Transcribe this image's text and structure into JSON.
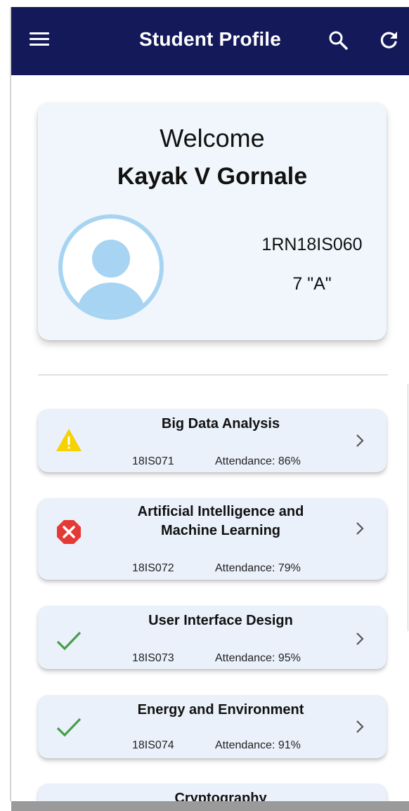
{
  "appbar": {
    "title": "Student Profile",
    "background": "#14195a"
  },
  "profile": {
    "welcome": "Welcome",
    "name": "Kayak V Gornale",
    "usn": "1RN18IS060",
    "section": "7  \"A\"",
    "avatar_color": "#a7d4f2"
  },
  "courses": [
    {
      "name": "Big Data Analysis",
      "code": "18IS071",
      "attendance": "Attendance: 86%",
      "status": "warning-icon"
    },
    {
      "name": "Artificial Intelligence and Machine Learning",
      "code": "18IS072",
      "attendance": "Attendance: 79%",
      "status": "error-icon"
    },
    {
      "name": "User Interface Design",
      "code": "18IS073",
      "attendance": "Attendance: 95%",
      "status": "check-icon"
    },
    {
      "name": "Energy and Environment",
      "code": "18IS074",
      "attendance": "Attendance: 91%",
      "status": "check-icon"
    },
    {
      "name": "Cryptography"
    }
  ],
  "colors": {
    "warning": "#f5d200",
    "error": "#e53935",
    "success": "#43a047",
    "card": "#eaf1fa"
  }
}
